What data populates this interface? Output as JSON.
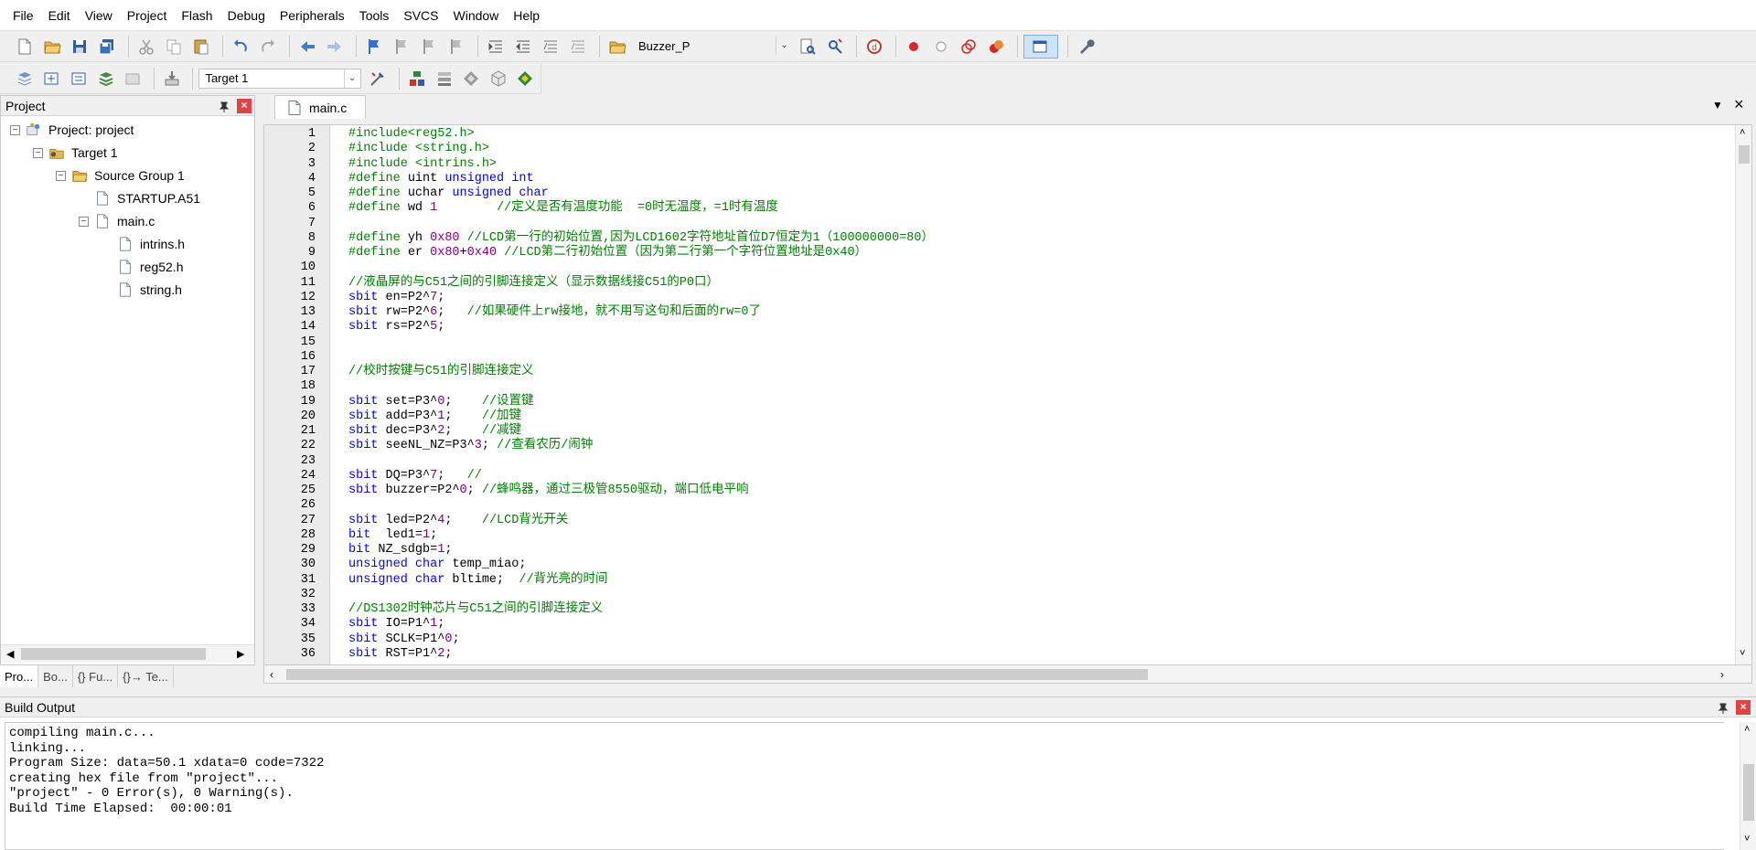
{
  "menubar": {
    "items": [
      "File",
      "Edit",
      "View",
      "Project",
      "Flash",
      "Debug",
      "Peripherals",
      "Tools",
      "SVCS",
      "Window",
      "Help"
    ]
  },
  "toolbar1": {
    "target_combo": "Buzzer_P",
    "icons_a": [
      "new-file-icon",
      "open-folder-icon",
      "save-icon",
      "save-all-icon"
    ],
    "icons_b": [
      "cut-icon",
      "copy-icon",
      "paste-icon"
    ],
    "icons_c": [
      "undo-icon",
      "redo-icon"
    ],
    "icons_d": [
      "nav-back-icon",
      "nav-forward-icon"
    ],
    "icons_e": [
      "bookmark-set-icon",
      "bookmark-prev-icon",
      "bookmark-next-icon",
      "bookmark-clear-icon"
    ],
    "icons_f": [
      "indent-icon",
      "unindent-icon",
      "comment-icon",
      "uncomment-icon"
    ],
    "icons_g": [
      "find-in-files-icon",
      "incremental-find-icon"
    ],
    "icons_h": [
      "debug-session-icon"
    ],
    "icons_i": [
      "breakpoint-insert-icon",
      "breakpoint-disable-icon",
      "breakpoint-disable-all-icon",
      "breakpoint-kill-all-icon"
    ],
    "icons_j": [
      "window-layout-icon"
    ],
    "icons_k": [
      "configure-icon"
    ]
  },
  "toolbar2": {
    "target_select": "Target 1",
    "icons_a": [
      "translate-icon",
      "build-icon",
      "rebuild-icon",
      "batch-build-icon",
      "stop-build-icon"
    ],
    "icons_b": [
      "download-icon"
    ],
    "icons_c": [
      "target-options-icon"
    ],
    "icons_d": [
      "file-extensions-icon",
      "manage-components-icon",
      "select-device-icon",
      "pack-installer-icon",
      "run-time-env-icon"
    ]
  },
  "project_panel": {
    "title": "Project",
    "tree": [
      {
        "label": "Project: project",
        "depth": 0,
        "expander": "−",
        "icon": "project-icon"
      },
      {
        "label": "Target 1",
        "depth": 1,
        "expander": "−",
        "icon": "target-icon"
      },
      {
        "label": "Source Group 1",
        "depth": 2,
        "expander": "−",
        "icon": "folder-icon"
      },
      {
        "label": "STARTUP.A51",
        "depth": 3,
        "expander": "",
        "icon": "file-icon"
      },
      {
        "label": "main.c",
        "depth": 3,
        "expander": "−",
        "icon": "file-icon"
      },
      {
        "label": "intrins.h",
        "depth": 4,
        "expander": "",
        "icon": "file-icon"
      },
      {
        "label": "reg52.h",
        "depth": 4,
        "expander": "",
        "icon": "file-icon"
      },
      {
        "label": "string.h",
        "depth": 4,
        "expander": "",
        "icon": "file-icon"
      }
    ],
    "tabs": [
      "Pro...",
      "Bo...",
      "{} Fu...",
      "{}→ Te..."
    ]
  },
  "editor": {
    "tab_label": "main.c",
    "lines": [
      {
        "n": "1",
        "t": [
          [
            "pp",
            "#include<reg52.h>"
          ]
        ]
      },
      {
        "n": "2",
        "t": [
          [
            "pp",
            "#include <string.h>"
          ]
        ]
      },
      {
        "n": "3",
        "t": [
          [
            "pp",
            "#include <intrins.h>"
          ]
        ]
      },
      {
        "n": "4",
        "t": [
          [
            "pp",
            "#define "
          ],
          [
            "pl",
            "uint "
          ],
          [
            "kw",
            "unsigned int"
          ]
        ]
      },
      {
        "n": "5",
        "t": [
          [
            "pp",
            "#define "
          ],
          [
            "pl",
            "uchar "
          ],
          [
            "kw",
            "unsigned char"
          ]
        ]
      },
      {
        "n": "6",
        "t": [
          [
            "pp",
            "#define "
          ],
          [
            "pl",
            "wd "
          ],
          [
            "nm",
            "1"
          ],
          [
            "cm",
            "        //定义是否有温度功能  =0时无温度，=1时有温度"
          ]
        ]
      },
      {
        "n": "7",
        "t": []
      },
      {
        "n": "8",
        "t": [
          [
            "pp",
            "#define "
          ],
          [
            "pl",
            "yh "
          ],
          [
            "nm",
            "0x80"
          ],
          [
            "cm",
            " //LCD第一行的初始位置,因为LCD1602字符地址首位D7恒定为1（100000000=80）"
          ]
        ]
      },
      {
        "n": "9",
        "t": [
          [
            "pp",
            "#define "
          ],
          [
            "pl",
            "er "
          ],
          [
            "nm",
            "0x80"
          ],
          [
            "pl",
            "+"
          ],
          [
            "nm",
            "0x40"
          ],
          [
            "cm",
            " //LCD第二行初始位置（因为第二行第一个字符位置地址是0x40）"
          ]
        ]
      },
      {
        "n": "10",
        "t": []
      },
      {
        "n": "11",
        "t": [
          [
            "cm",
            "//液晶屏的与C51之间的引脚连接定义（显示数据线接C51的P0口）"
          ]
        ]
      },
      {
        "n": "12",
        "t": [
          [
            "kw",
            "sbit "
          ],
          [
            "pl",
            "en=P2^"
          ],
          [
            "nm",
            "7"
          ],
          [
            "pl",
            ";"
          ]
        ]
      },
      {
        "n": "13",
        "t": [
          [
            "kw",
            "sbit "
          ],
          [
            "pl",
            "rw=P2^"
          ],
          [
            "nm",
            "6"
          ],
          [
            "pl",
            ";   "
          ],
          [
            "cm",
            "//如果硬件上rw接地，就不用写这句和后面的rw=0了"
          ]
        ]
      },
      {
        "n": "14",
        "t": [
          [
            "kw",
            "sbit "
          ],
          [
            "pl",
            "rs=P2^"
          ],
          [
            "nm",
            "5"
          ],
          [
            "pl",
            ";"
          ]
        ]
      },
      {
        "n": "15",
        "t": []
      },
      {
        "n": "16",
        "t": []
      },
      {
        "n": "17",
        "t": [
          [
            "cm",
            "//校时按键与C51的引脚连接定义"
          ]
        ]
      },
      {
        "n": "18",
        "t": []
      },
      {
        "n": "19",
        "t": [
          [
            "kw",
            "sbit "
          ],
          [
            "pl",
            "set=P3^"
          ],
          [
            "nm",
            "0"
          ],
          [
            "pl",
            ";    "
          ],
          [
            "cm",
            "//设置键"
          ]
        ]
      },
      {
        "n": "20",
        "t": [
          [
            "kw",
            "sbit "
          ],
          [
            "pl",
            "add=P3^"
          ],
          [
            "nm",
            "1"
          ],
          [
            "pl",
            ";    "
          ],
          [
            "cm",
            "//加键"
          ]
        ]
      },
      {
        "n": "21",
        "t": [
          [
            "kw",
            "sbit "
          ],
          [
            "pl",
            "dec=P3^"
          ],
          [
            "nm",
            "2"
          ],
          [
            "pl",
            ";    "
          ],
          [
            "cm",
            "//减键"
          ]
        ]
      },
      {
        "n": "22",
        "t": [
          [
            "kw",
            "sbit "
          ],
          [
            "pl",
            "seeNL_NZ=P3^"
          ],
          [
            "nm",
            "3"
          ],
          [
            "pl",
            "; "
          ],
          [
            "cm",
            "//查看农历/闹钟"
          ]
        ]
      },
      {
        "n": "23",
        "t": []
      },
      {
        "n": "24",
        "t": [
          [
            "kw",
            "sbit "
          ],
          [
            "pl",
            "DQ=P3^"
          ],
          [
            "nm",
            "7"
          ],
          [
            "pl",
            ";   "
          ],
          [
            "cm",
            "//"
          ]
        ]
      },
      {
        "n": "25",
        "t": [
          [
            "kw",
            "sbit "
          ],
          [
            "pl",
            "buzzer=P2^"
          ],
          [
            "nm",
            "0"
          ],
          [
            "pl",
            "; "
          ],
          [
            "cm",
            "//蜂鸣器，通过三极管8550驱动，端口低电平响"
          ]
        ]
      },
      {
        "n": "26",
        "t": []
      },
      {
        "n": "27",
        "t": [
          [
            "kw",
            "sbit "
          ],
          [
            "pl",
            "led=P2^"
          ],
          [
            "nm",
            "4"
          ],
          [
            "pl",
            ";    "
          ],
          [
            "cm",
            "//LCD背光开关"
          ]
        ]
      },
      {
        "n": "28",
        "t": [
          [
            "kw",
            "bit "
          ],
          [
            "pl",
            " led1="
          ],
          [
            "nm",
            "1"
          ],
          [
            "pl",
            ";"
          ]
        ]
      },
      {
        "n": "29",
        "t": [
          [
            "kw",
            "bit "
          ],
          [
            "pl",
            "NZ_sdgb="
          ],
          [
            "nm",
            "1"
          ],
          [
            "pl",
            ";"
          ]
        ]
      },
      {
        "n": "30",
        "t": [
          [
            "kw",
            "unsigned char "
          ],
          [
            "pl",
            "temp_miao;"
          ]
        ]
      },
      {
        "n": "31",
        "t": [
          [
            "kw",
            "unsigned char "
          ],
          [
            "pl",
            "bltime;  "
          ],
          [
            "cm",
            "//背光亮的时间"
          ]
        ]
      },
      {
        "n": "32",
        "t": []
      },
      {
        "n": "33",
        "t": [
          [
            "cm",
            "//DS1302时钟芯片与C51之间的引脚连接定义"
          ]
        ]
      },
      {
        "n": "34",
        "t": [
          [
            "kw",
            "sbit "
          ],
          [
            "pl",
            "IO=P1^"
          ],
          [
            "nm",
            "1"
          ],
          [
            "pl",
            ";"
          ]
        ]
      },
      {
        "n": "35",
        "t": [
          [
            "kw",
            "sbit "
          ],
          [
            "pl",
            "SCLK=P1^"
          ],
          [
            "nm",
            "0"
          ],
          [
            "pl",
            ";"
          ]
        ]
      },
      {
        "n": "36",
        "t": [
          [
            "kw",
            "sbit "
          ],
          [
            "pl",
            "RST=P1^"
          ],
          [
            "nm",
            "2"
          ],
          [
            "pl",
            ";"
          ]
        ]
      }
    ]
  },
  "build_output": {
    "title": "Build Output",
    "lines": [
      "compiling main.c...",
      "linking...",
      "Program Size: data=50.1 xdata=0 code=7322",
      "creating hex file from \"project\"...",
      "\"project\" - 0 Error(s), 0 Warning(s).",
      "Build Time Elapsed:  00:00:01"
    ]
  },
  "colors": {
    "keyword": "#0000ff",
    "comment": "#008000",
    "number": "#800080",
    "preprocessor": "#008000"
  }
}
